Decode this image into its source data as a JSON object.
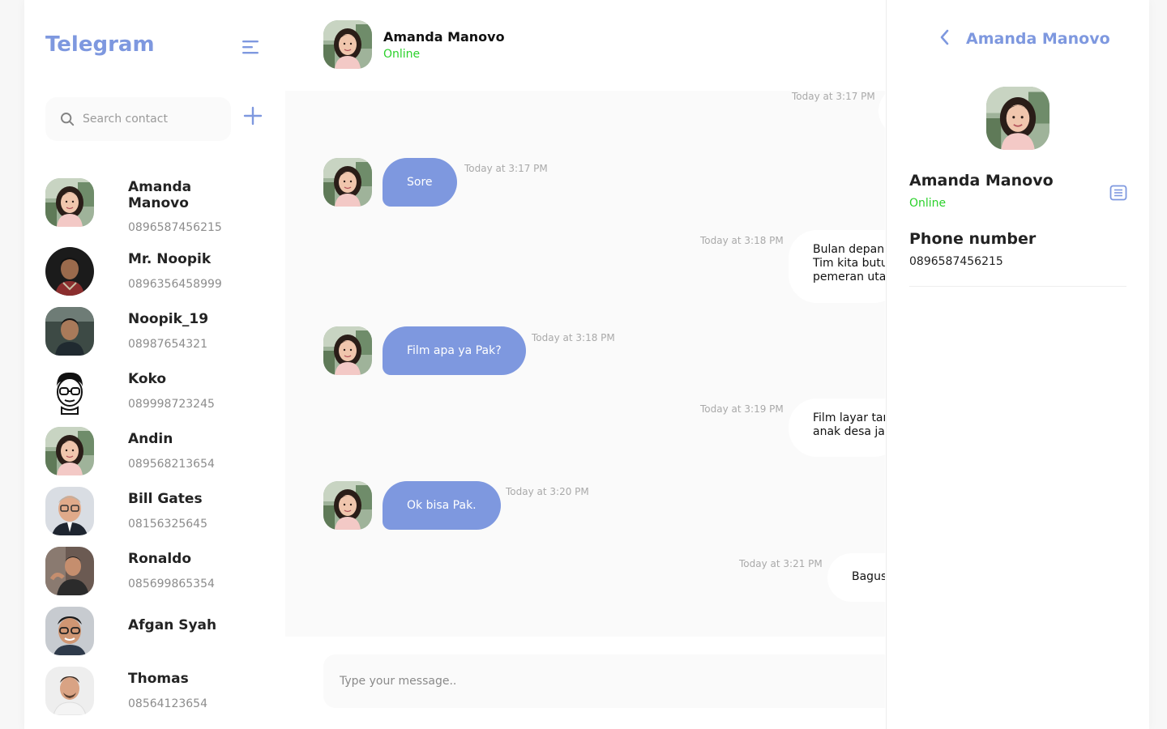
{
  "sidebar": {
    "brand": "Telegram",
    "search_placeholder": "Search contact",
    "contacts": [
      {
        "name": "Amanda Manovo",
        "phone": "0896587456215"
      },
      {
        "name": "Mr. Noopik",
        "phone": "0896356458999"
      },
      {
        "name": "Noopik_19",
        "phone": "08987654321"
      },
      {
        "name": "Koko",
        "phone": "089998723245"
      },
      {
        "name": "Andin",
        "phone": "089568213654"
      },
      {
        "name": "Bill Gates",
        "phone": "08156325645"
      },
      {
        "name": "Ronaldo",
        "phone": "085699865354"
      },
      {
        "name": "Afgan Syah",
        "phone": ""
      },
      {
        "name": "Thomas",
        "phone": "08564123654"
      }
    ]
  },
  "chat": {
    "header": {
      "name": "Amanda Manovo",
      "status": "Online"
    },
    "messages": [
      {
        "direction": "out",
        "text": "",
        "time": "Today at 3:17 PM"
      },
      {
        "direction": "in",
        "text": "Sore",
        "time": "Today at 3:17 PM"
      },
      {
        "direction": "out",
        "lines": [
          "Bulan depan",
          "Tim kita butu",
          "pemeran uta"
        ],
        "time": "Today at 3:18 PM"
      },
      {
        "direction": "in",
        "text": "Film apa ya Pak?",
        "time": "Today at 3:18 PM"
      },
      {
        "direction": "out",
        "lines": [
          "Film layar tar",
          "anak desa jac"
        ],
        "time": "Today at 3:19 PM"
      },
      {
        "direction": "in",
        "text": "Ok bisa Pak.",
        "time": "Today at 3:20 PM"
      },
      {
        "direction": "out",
        "text": "Bagus",
        "time": "Today at 3:21 PM"
      }
    ],
    "composer_placeholder": "Type your message.."
  },
  "profile": {
    "title": "Amanda Manovo",
    "name": "Amanda Manovo",
    "status": "Online",
    "phone_label": "Phone number",
    "phone": "0896587456215"
  },
  "colors": {
    "accent": "#7e98df",
    "online": "#2bd12b",
    "chat_bg": "#fafafa"
  },
  "icons": {
    "menu": "hamburger-menu-icon",
    "search": "search-icon",
    "add": "plus-icon",
    "back": "chevron-left-icon",
    "chat": "chat-list-icon"
  }
}
